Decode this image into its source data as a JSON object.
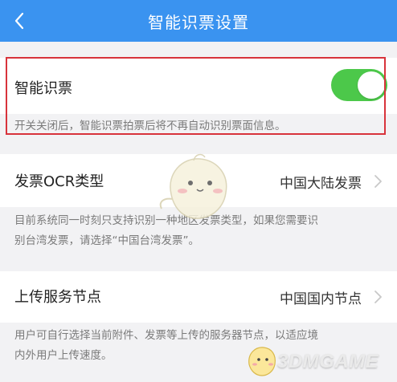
{
  "header": {
    "title": "智能识票设置"
  },
  "smart_ticket": {
    "label": "智能识票",
    "enabled": true,
    "note": "开关关闭后，智能识票拍票后将不再自动识别票面信息。"
  },
  "ocr_type": {
    "label": "发票OCR类型",
    "value": "中国大陆发票",
    "note_line1": "目前系统同一时刻只支持识别一种地区发票类型，如果您需要识",
    "note_line2": "别台湾发票，请选择“中国台湾发票”。"
  },
  "upload_node": {
    "label": "上传服务节点",
    "value": "中国国内节点",
    "note_line1": "用户可自行选择当前附件、发票等上传的服务器节点，以适应境",
    "note_line2": "内外用户上传速度。"
  },
  "watermark": {
    "text": "3DMGAME"
  },
  "colors": {
    "header": "#3a93f0",
    "toggle_on": "#4cc84a",
    "highlight": "#d8333b",
    "background": "#f2f2f4"
  }
}
